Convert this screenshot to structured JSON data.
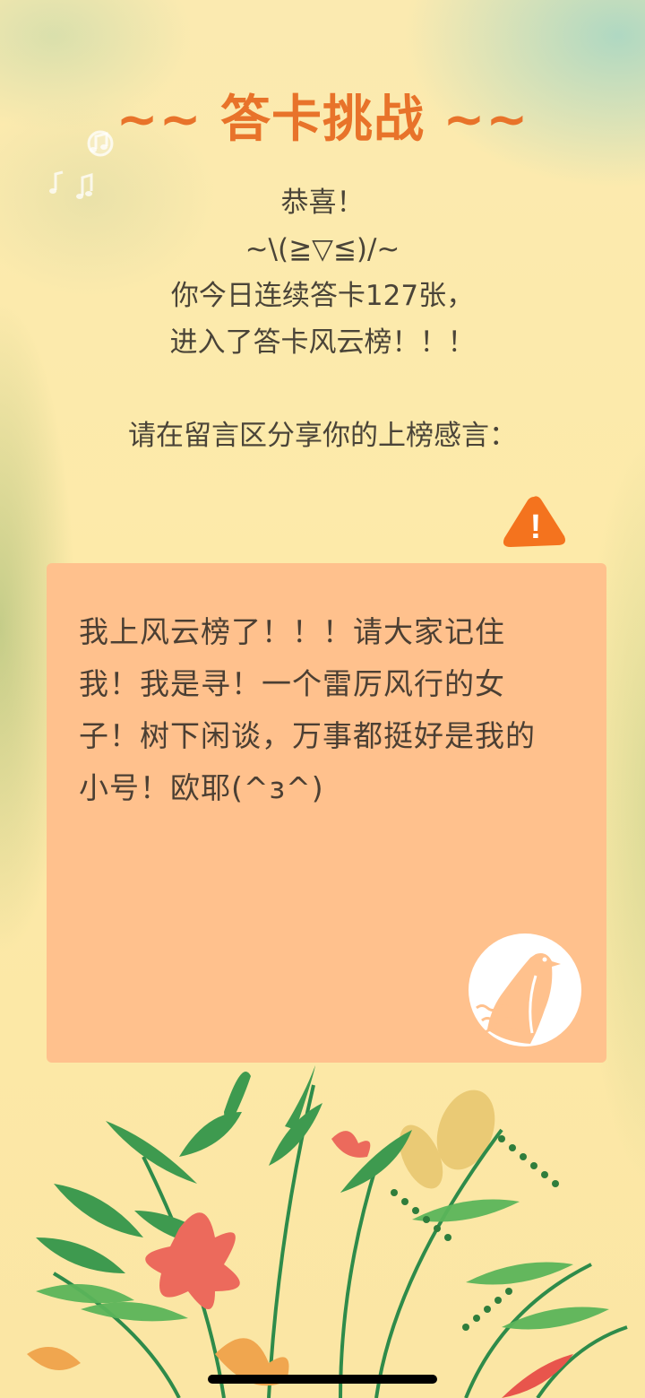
{
  "title": "~~ 答卡挑战 ~~",
  "intro": {
    "line1": "恭喜！",
    "line2": "~\\(≧▽≦)/~",
    "line3": "你今日连续答卡127张，",
    "line4": "进入了答卡风云榜！！！"
  },
  "prompt": "请在留言区分享你的上榜感言：",
  "report": {
    "label": "!"
  },
  "card": {
    "message": "我上风云榜了！！！请大家记住我！我是寻！一个雷厉风行的女子！树下闲谈，万事都挺好是我的小号！欧耶(^з^)"
  },
  "icons": {
    "report": "warning-triangle-icon",
    "logo": "bird-logo-icon",
    "notes": "music-notes-icon"
  },
  "colors": {
    "background": "#fdeaa8",
    "title": "#e8732a",
    "text": "#4a4438",
    "card": "#ffc18d",
    "warning": "#f4731e"
  }
}
